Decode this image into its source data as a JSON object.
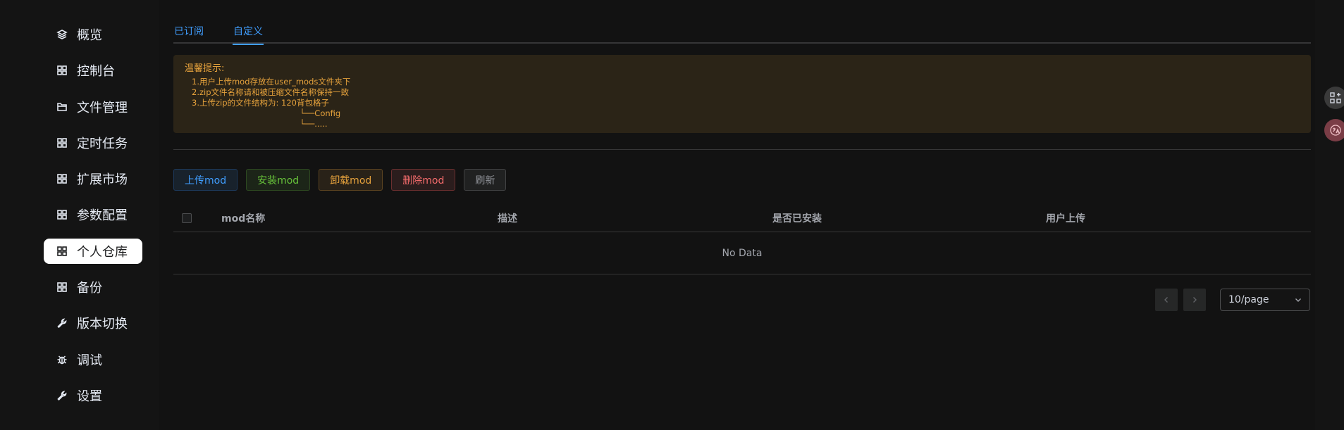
{
  "sidebar": {
    "items": [
      {
        "label": "概览",
        "icon": "layers-icon"
      },
      {
        "label": "控制台",
        "icon": "grid-icon"
      },
      {
        "label": "文件管理",
        "icon": "folder-icon"
      },
      {
        "label": "定时任务",
        "icon": "grid-icon"
      },
      {
        "label": "扩展市场",
        "icon": "grid-icon"
      },
      {
        "label": "参数配置",
        "icon": "grid-icon"
      },
      {
        "label": "个人仓库",
        "icon": "grid-icon",
        "active": true
      },
      {
        "label": "备份",
        "icon": "grid-icon"
      },
      {
        "label": "版本切换",
        "icon": "wrench-icon"
      },
      {
        "label": "调试",
        "icon": "bug-icon"
      },
      {
        "label": "设置",
        "icon": "wrench-icon"
      }
    ]
  },
  "tabs": [
    {
      "label": "已订阅"
    },
    {
      "label": "自定义",
      "active": true
    }
  ],
  "alert": {
    "title": "温馨提示:",
    "lines": [
      "1.用户上传mod存放在user_mods文件夹下",
      "2.zip文件名称请和被压缩文件名称保持一致",
      "3.上传zip的文件结构为: 120背包格子",
      "                                          └──Config",
      "                                          └──....."
    ]
  },
  "toolbar": {
    "upload": "上传mod",
    "install": "安装mod",
    "uninstall": "卸载mod",
    "delete": "删除mod",
    "refresh": "刷新"
  },
  "table": {
    "columns": [
      "mod名称",
      "描述",
      "是否已安装",
      "用户上传"
    ],
    "empty_text": "No Data"
  },
  "pagination": {
    "page_size": "10/page"
  },
  "colors": {
    "accent": "#409eff",
    "success": "#67c23a",
    "warning": "#e6a23c",
    "danger": "#f56c6c",
    "info": "#909399"
  }
}
